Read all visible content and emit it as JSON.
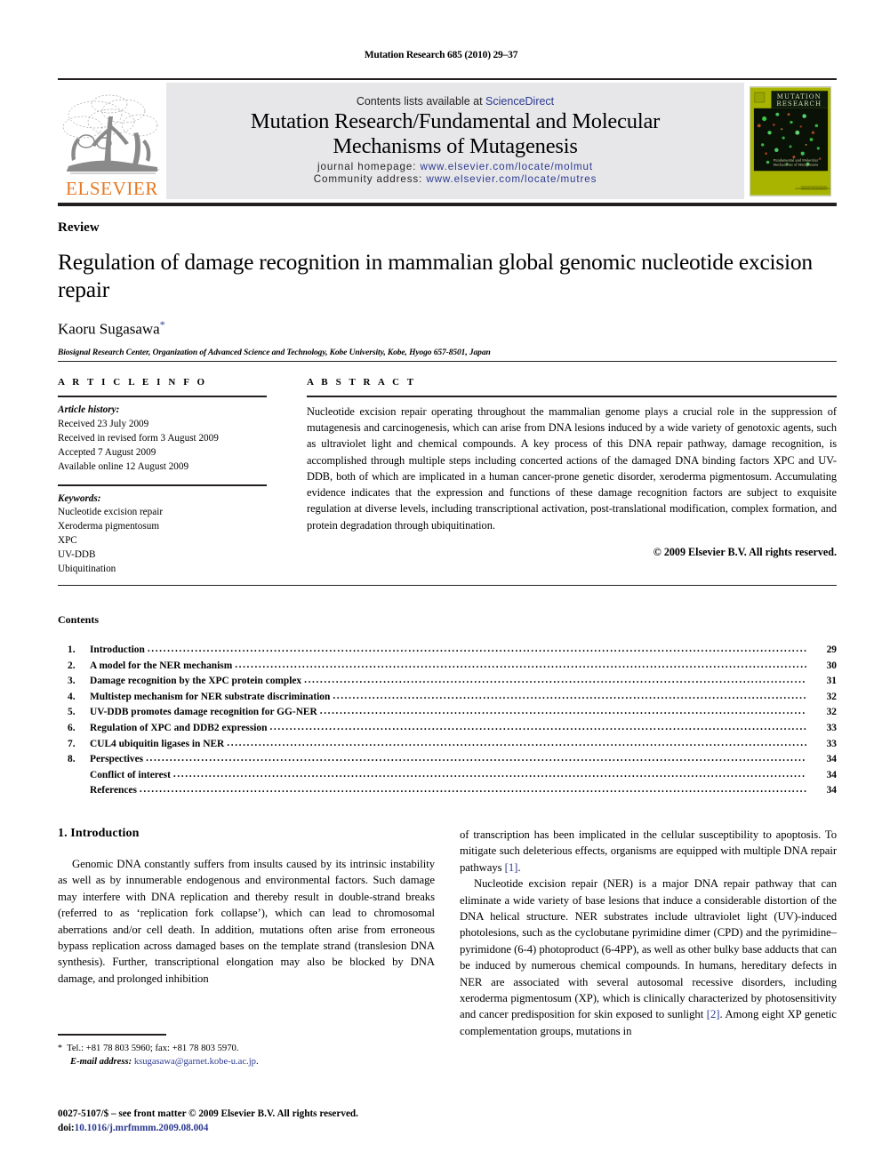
{
  "running_head": "Mutation Research 685 (2010) 29–37",
  "masthead": {
    "contents_prefix": "Contents lists available at ",
    "sciencedirect": "ScienceDirect",
    "journal_title_line1": "Mutation Research/Fundamental and Molecular",
    "journal_title_line2": "Mechanisms of Mutagenesis",
    "homepage_label": "journal homepage:",
    "homepage_url": "www.elsevier.com/locate/molmut",
    "community_label": "Community address:",
    "community_url": "www.elsevier.com/locate/mutres",
    "publisher_wordmark": "ELSEVIER",
    "publisher_logo_icon": "elsevier-tree-logo",
    "cover_title_line1": "MUTATION",
    "cover_title_line2": "RESEARCH",
    "cover_subtitle_line1": "Fundamental and Molecular",
    "cover_subtitle_line2": "Mechanisms of Mutagenesis",
    "cover_footer": "www.elsevier.com/locate/molmut"
  },
  "title_block": {
    "article_type": "Review",
    "title": "Regulation of damage recognition in mammalian global genomic nucleotide excision repair",
    "author": "Kaoru Sugasawa",
    "corresponding_marker": "*",
    "affiliation": "Biosignal Research Center, Organization of Advanced Science and Technology, Kobe University, Kobe, Hyogo 657-8501, Japan"
  },
  "article_info": {
    "heading": "A R T I C L E    I N F O",
    "history_label": "Article history:",
    "history": [
      "Received 23 July 2009",
      "Received in revised form 3 August 2009",
      "Accepted 7 August 2009",
      "Available online 12 August 2009"
    ],
    "keywords_label": "Keywords:",
    "keywords": [
      "Nucleotide excision repair",
      "Xeroderma pigmentosum",
      "XPC",
      "UV-DDB",
      "Ubiquitination"
    ]
  },
  "abstract": {
    "heading": "A B S T R A C T",
    "text": "Nucleotide excision repair operating throughout the mammalian genome plays a crucial role in the suppression of mutagenesis and carcinogenesis, which can arise from DNA lesions induced by a wide variety of genotoxic agents, such as ultraviolet light and chemical compounds. A key process of this DNA repair pathway, damage recognition, is accomplished through multiple steps including concerted actions of the damaged DNA binding factors XPC and UV-DDB, both of which are implicated in a human cancer-prone genetic disorder, xeroderma pigmentosum. Accumulating evidence indicates that the expression and functions of these damage recognition factors are subject to exquisite regulation at diverse levels, including transcriptional activation, post-translational modification, complex formation, and protein degradation through ubiquitination.",
    "copyright": "© 2009 Elsevier B.V. All rights reserved."
  },
  "contents": {
    "heading": "Contents",
    "entries": [
      {
        "num": "1.",
        "label": "Introduction",
        "page": "29"
      },
      {
        "num": "2.",
        "label": "A model for the NER mechanism",
        "page": "30"
      },
      {
        "num": "3.",
        "label": "Damage recognition by the XPC protein complex",
        "page": "31"
      },
      {
        "num": "4.",
        "label": "Multistep mechanism for NER substrate discrimination",
        "page": "32"
      },
      {
        "num": "5.",
        "label": "UV-DDB promotes damage recognition for GG-NER",
        "page": "32"
      },
      {
        "num": "6.",
        "label": "Regulation of XPC and DDB2 expression",
        "page": "33"
      },
      {
        "num": "7.",
        "label": "CUL4 ubiquitin ligases in NER",
        "page": "33"
      },
      {
        "num": "8.",
        "label": "Perspectives",
        "page": "34"
      },
      {
        "num": "",
        "label": "Conflict of interest",
        "page": "34"
      },
      {
        "num": "",
        "label": "References",
        "page": "34"
      }
    ]
  },
  "body": {
    "section_heading": "1.  Introduction",
    "left_p1": "Genomic DNA constantly suffers from insults caused by its intrinsic instability as well as by innumerable endogenous and environmental factors. Such damage may interfere with DNA replication and thereby result in double-strand breaks (referred to as ‘replication fork collapse’), which can lead to chromosomal aberrations and/or cell death. In addition, mutations often arise from erroneous bypass replication across damaged bases on the template strand (translesion DNA synthesis). Further, transcriptional elongation may also be blocked by DNA damage, and prolonged inhibition",
    "right_p1_continued": "of transcription has been implicated in the cellular susceptibility to apoptosis. To mitigate such deleterious effects, organisms are equipped with multiple DNA repair pathways ",
    "right_p1_ref": "[1]",
    "right_p1_tail": ".",
    "right_p2_a": "Nucleotide excision repair (NER) is a major DNA repair pathway that can eliminate a wide variety of base lesions that induce a considerable distortion of the DNA helical structure. NER substrates include ultraviolet light (UV)-induced photolesions, such as the cyclobutane pyrimidine dimer (CPD) and the pyrimidine–pyrimidone (6-4) photoproduct (6-4PP), as well as other bulky base adducts that can be induced by numerous chemical compounds. In humans, hereditary defects in NER are associated with several autosomal recessive disorders, including xeroderma pigmentosum (XP), which is clinically characterized by photosensitivity and cancer predisposition for skin exposed to sunlight ",
    "right_p2_ref": "[2]",
    "right_p2_tail": ". Among eight XP genetic complementation groups, mutations in"
  },
  "footnote": {
    "marker": "*",
    "contact": "Tel.: +81 78 803 5960; fax: +81 78 803 5970.",
    "email_label": "E-mail address:",
    "email": "ksugasawa@garnet.kobe-u.ac.jp",
    "email_tail": "."
  },
  "publisher_footer": {
    "line1": "0027-5107/$ – see front matter © 2009 Elsevier B.V. All rights reserved.",
    "doi_label": "doi:",
    "doi": "10.1016/j.mrfmmm.2009.08.004"
  },
  "colors": {
    "link_blue": "#2b3990",
    "elsevier_orange": "#e87722",
    "band_gray": "#e7e7e9",
    "cover_olive": "#a8b400",
    "rule_black": "#231f20"
  }
}
